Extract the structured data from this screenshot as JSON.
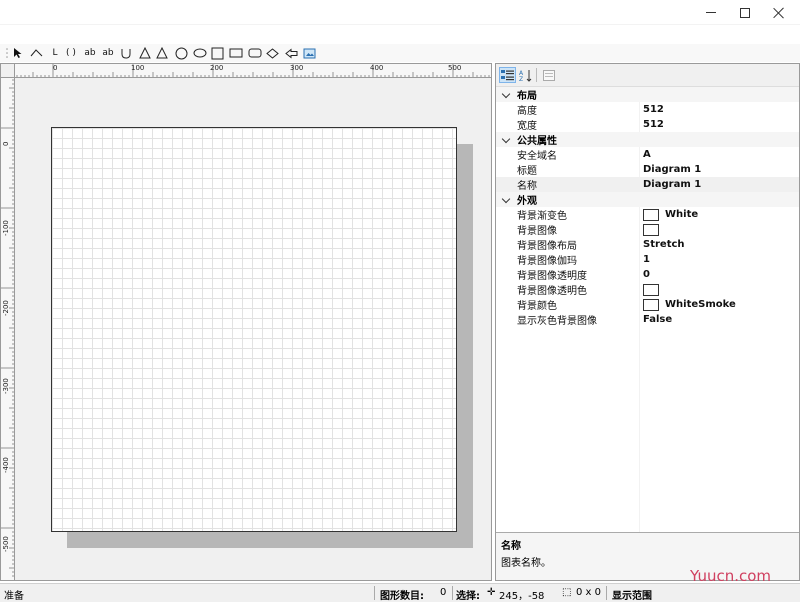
{
  "window": {
    "minimize_label": "minimize",
    "maximize_label": "maximize",
    "close_label": "close"
  },
  "toolbar": {
    "tools": [
      {
        "name": "pointer-tool",
        "icon": "pointer-icon"
      },
      {
        "name": "polyline-tool",
        "icon": "polyline-icon"
      },
      {
        "name": "angle-tool",
        "icon": "angle-icon",
        "text": "L"
      },
      {
        "name": "paren-tool",
        "icon": "paren-icon",
        "text": "( )"
      },
      {
        "name": "text-tool",
        "icon": "text-icon",
        "text": "ab"
      },
      {
        "name": "textbox-tool",
        "icon": "textbox-icon",
        "text": "ab"
      },
      {
        "name": "cup-tool",
        "icon": "cup-icon"
      },
      {
        "name": "triangle-tool",
        "icon": "triangle-icon"
      },
      {
        "name": "right-triangle-tool",
        "icon": "triangle-outline-icon"
      },
      {
        "name": "circle-tool",
        "icon": "circle-icon"
      },
      {
        "name": "ellipse-tool",
        "icon": "ellipse-icon"
      },
      {
        "name": "square-tool",
        "icon": "square-icon"
      },
      {
        "name": "rectangle-tool",
        "icon": "rectangle-icon"
      },
      {
        "name": "rounded-rect-tool",
        "icon": "rounded-rectangle-icon"
      },
      {
        "name": "diamond-tool",
        "icon": "diamond-icon"
      },
      {
        "name": "arrow-tool",
        "icon": "left-arrow-icon"
      },
      {
        "name": "image-tool",
        "icon": "image-icon"
      }
    ]
  },
  "ruler": {
    "h_labels": [
      "0",
      "100",
      "200",
      "300",
      "400",
      "500"
    ],
    "v_labels": [
      "0",
      "-100",
      "-200",
      "-300",
      "-400",
      "-500"
    ]
  },
  "properties": {
    "categories": [
      {
        "label": "布局",
        "items": [
          {
            "name": "高度",
            "value": "512"
          },
          {
            "name": "宽度",
            "value": "512"
          }
        ]
      },
      {
        "label": "公共属性",
        "items": [
          {
            "name": "安全域名",
            "value": "A"
          },
          {
            "name": "标题",
            "value": "Diagram 1"
          },
          {
            "name": "名称",
            "value": "Diagram 1"
          }
        ]
      },
      {
        "label": "外观",
        "items": [
          {
            "name": "背景渐变色",
            "value": "White"
          },
          {
            "name": "背景图像",
            "value": ""
          },
          {
            "name": "背景图像布局",
            "value": "Stretch"
          },
          {
            "name": "背景图像伽玛",
            "value": "1"
          },
          {
            "name": "背景图像透明度",
            "value": "0"
          },
          {
            "name": "背景图像透明色",
            "value": ""
          },
          {
            "name": "背景颜色",
            "value": "WhiteSmoke"
          },
          {
            "name": "显示灰色背景图像",
            "value": "False"
          }
        ]
      }
    ],
    "description": {
      "title": "名称",
      "text": "图表名称。"
    }
  },
  "status": {
    "ready": "准备",
    "shape_count_label": "图形数目:",
    "shape_count": "0",
    "selection_label": "选择:",
    "cursor_pos": "245，-58",
    "selection_size": "0 x 0",
    "view_range_label": "显示范围"
  },
  "watermark": {
    "text": "Yuucn.com"
  },
  "colors": {
    "canvas_bg": "#ffffff",
    "grid_line": "#e2e2e2",
    "selection_highlight": "#cde4f7"
  }
}
